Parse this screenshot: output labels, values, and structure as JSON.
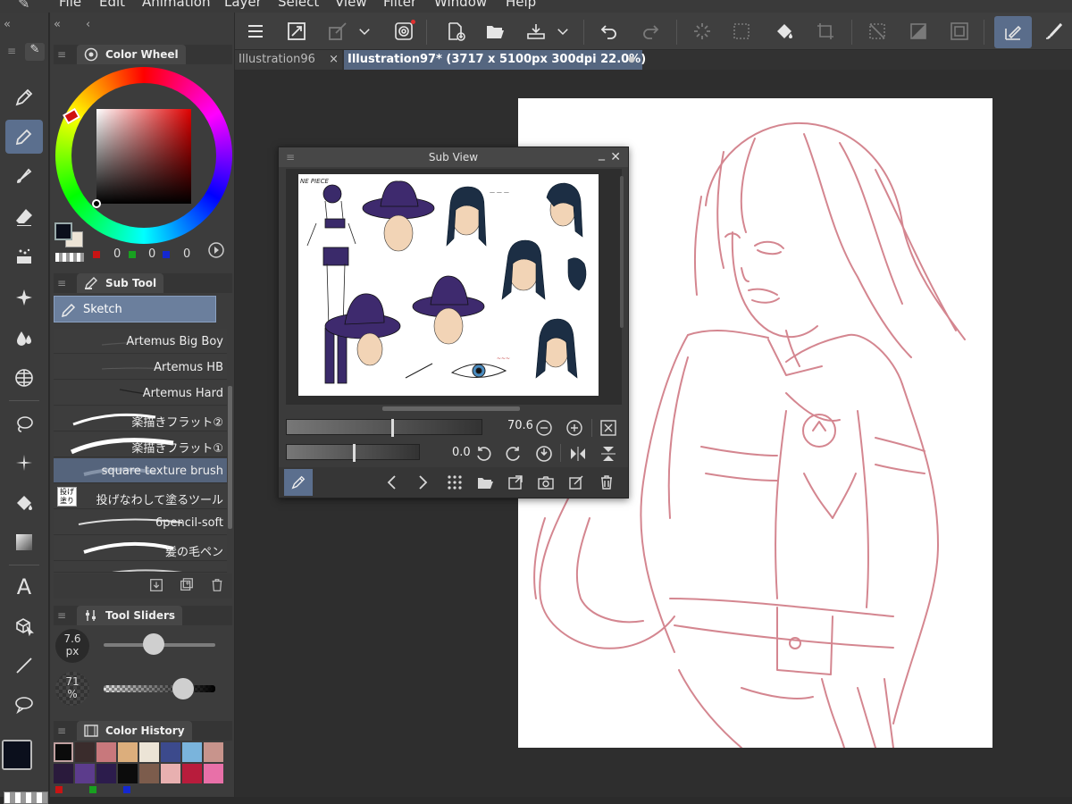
{
  "menu": {
    "items": [
      "File",
      "Edit",
      "Animation",
      "Layer",
      "Select",
      "View",
      "Filter",
      "Window",
      "Help"
    ]
  },
  "tabs": [
    {
      "label": "Illustration96",
      "close": "×"
    },
    {
      "label": "Illustration97* (3717 x 5100px 300dpi 22.0%)",
      "close": "●"
    }
  ],
  "color_wheel": {
    "title": "Color Wheel",
    "rgb": {
      "r": "0",
      "g": "0",
      "b": "0"
    },
    "main_color": "#0b0f1c",
    "sub_color": "#ece4d6"
  },
  "sub_tool": {
    "title": "Sub Tool",
    "group": "Sketch",
    "brushes": [
      "Artemus Big Boy",
      "Artemus HB",
      "Artemus Hard",
      "楽描きフラット②",
      "楽描きフラット①",
      "square texture brush",
      "投げなわして塗るツール",
      "6pencil-soft",
      "髪の毛ペン"
    ],
    "selected": "square texture brush"
  },
  "tool_sliders": {
    "title": "Tool Sliders",
    "size_value": "7.6",
    "size_unit": "px",
    "size_level": 0.45,
    "opacity_value": "71",
    "opacity_unit": "%",
    "opacity_level": 0.71
  },
  "color_history": {
    "title": "Color History",
    "swatches": [
      "#0b0b0b",
      "#3a2c2c",
      "#c8787c",
      "#dcae7c",
      "#ece4d6",
      "#3c4a8c",
      "#7ab4dc",
      "#c8948c",
      "#2a1a3c",
      "#5c3c8c",
      "#2c1c4c",
      "#0c0c0c",
      "#7c5c4c",
      "#e8b0b0",
      "#b81c3c",
      "#e870a8"
    ]
  },
  "sub_view": {
    "title": "Sub View",
    "zoom_value": "70.6",
    "rotate_value": "0.0"
  },
  "reference_text": {
    "title": "NE PIECE"
  }
}
